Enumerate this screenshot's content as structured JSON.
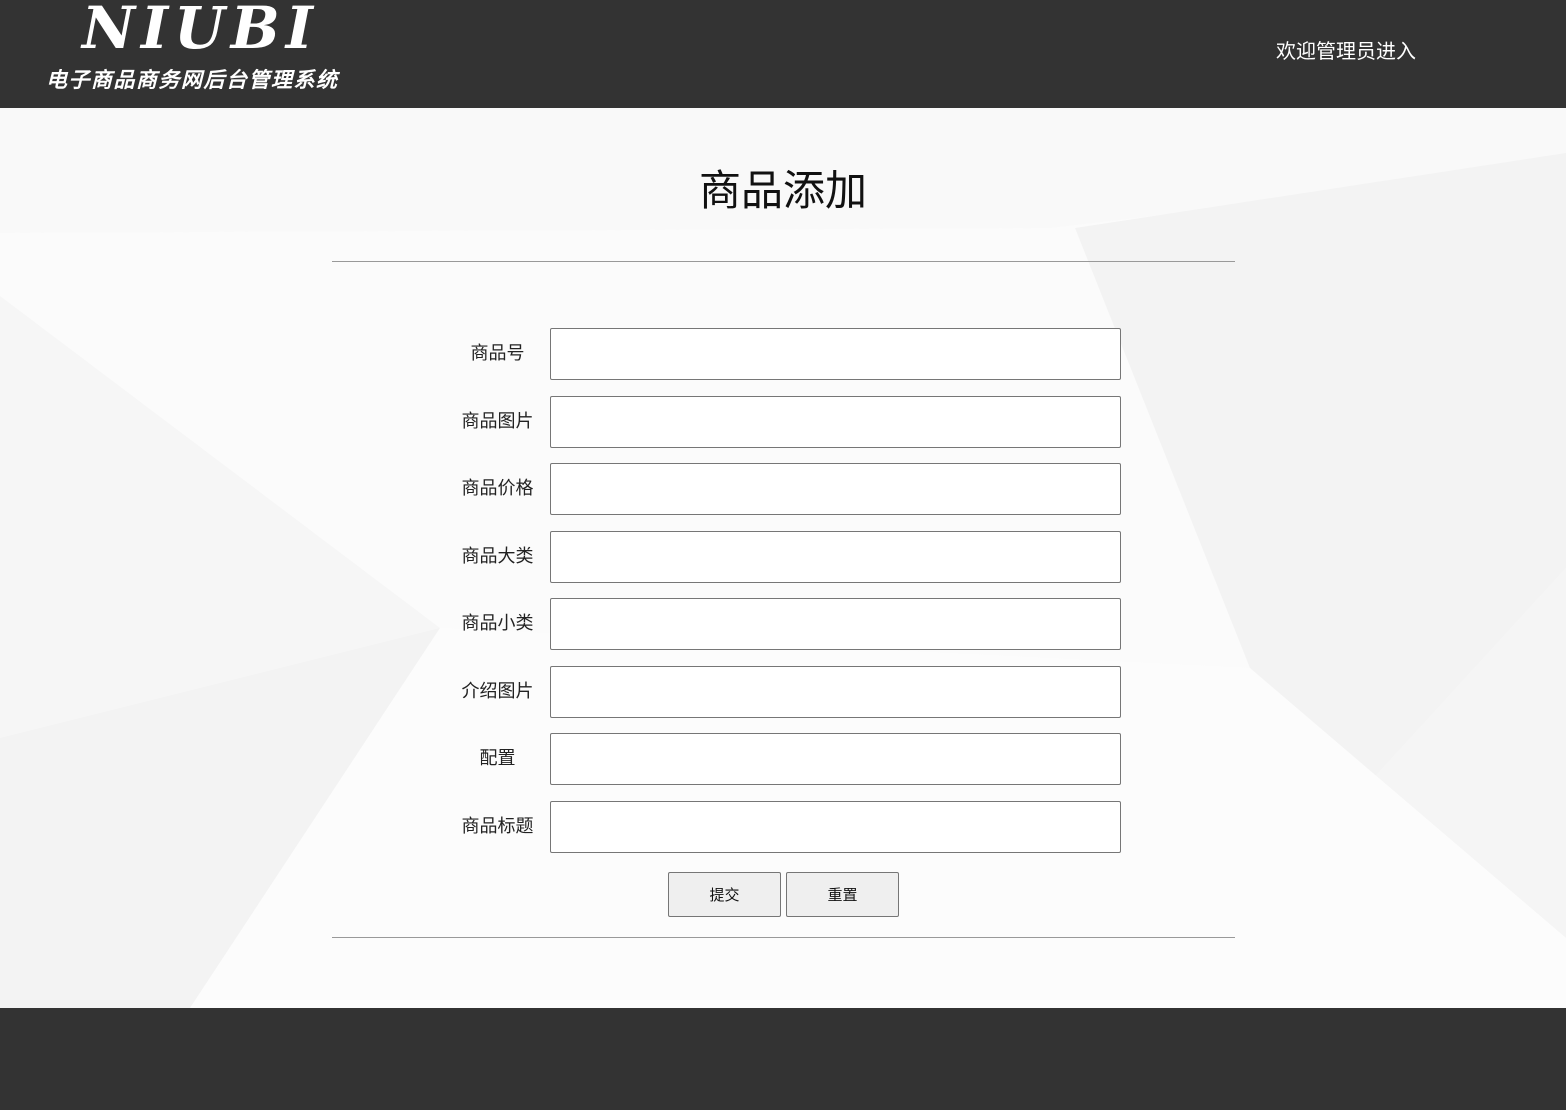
{
  "header": {
    "logo_title": "NIUBI",
    "logo_subtitle": "电子商品商务网后台管理系统",
    "welcome": "欢迎管理员进入"
  },
  "page": {
    "title": "商品添加"
  },
  "form": {
    "fields": [
      {
        "label": "商品号",
        "value": ""
      },
      {
        "label": "商品图片",
        "value": ""
      },
      {
        "label": "商品价格",
        "value": ""
      },
      {
        "label": "商品大类",
        "value": ""
      },
      {
        "label": "商品小类",
        "value": ""
      },
      {
        "label": "介绍图片",
        "value": ""
      },
      {
        "label": "配置",
        "value": ""
      },
      {
        "label": "商品标题",
        "value": ""
      }
    ],
    "submit_label": "提交",
    "reset_label": "重置"
  },
  "colors": {
    "header_bg": "#333333",
    "footer_bg": "#333333",
    "content_bg": "#fbfbfb"
  }
}
